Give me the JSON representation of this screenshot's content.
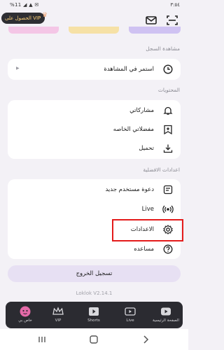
{
  "status_bar": {
    "left": "%11 ◢ ▲ ✉",
    "right": "٣:٥٤"
  },
  "header": {
    "vip_label": "الحصول على VIP"
  },
  "sections": {
    "history_title": "مشاهدة السجل",
    "content_title": "المحتويات",
    "settings_title": "اعدادات الافضلية"
  },
  "history": {
    "continue_label": "استمر في المشاهدة",
    "arrow": "▶"
  },
  "content": {
    "items": [
      {
        "label": "مشاركاتي",
        "icon": "bell-icon"
      },
      {
        "label": "مفضلاتي الخاصه",
        "icon": "bookmark-plus-icon"
      },
      {
        "label": "تحميل",
        "icon": "download-icon"
      }
    ]
  },
  "prefs": {
    "items": [
      {
        "label": "دعوة مستخدم جديد",
        "icon": "invite-icon"
      },
      {
        "label": "Live",
        "icon": "broadcast-icon"
      },
      {
        "label": "الاعدادات",
        "icon": "gear-icon"
      },
      {
        "label": "مساعده",
        "icon": "help-icon"
      }
    ]
  },
  "logout_label": "تسجيل الخروج",
  "version": "Loklok V2.14.1",
  "nav": [
    {
      "label": "خاص بي",
      "icon": "profile-icon"
    },
    {
      "label": "VIP",
      "icon": "vip-icon"
    },
    {
      "label": "Shorts",
      "icon": "shorts-icon"
    },
    {
      "label": "Live",
      "icon": "live-icon"
    },
    {
      "label": "الصفحة الرئيسية",
      "icon": "home-icon"
    }
  ],
  "colors": {
    "accent": "#e31b1b",
    "nav_bg": "#2b2b31",
    "logout_bg": "#e7e0f3",
    "page_bg": "#f3f1f6"
  }
}
